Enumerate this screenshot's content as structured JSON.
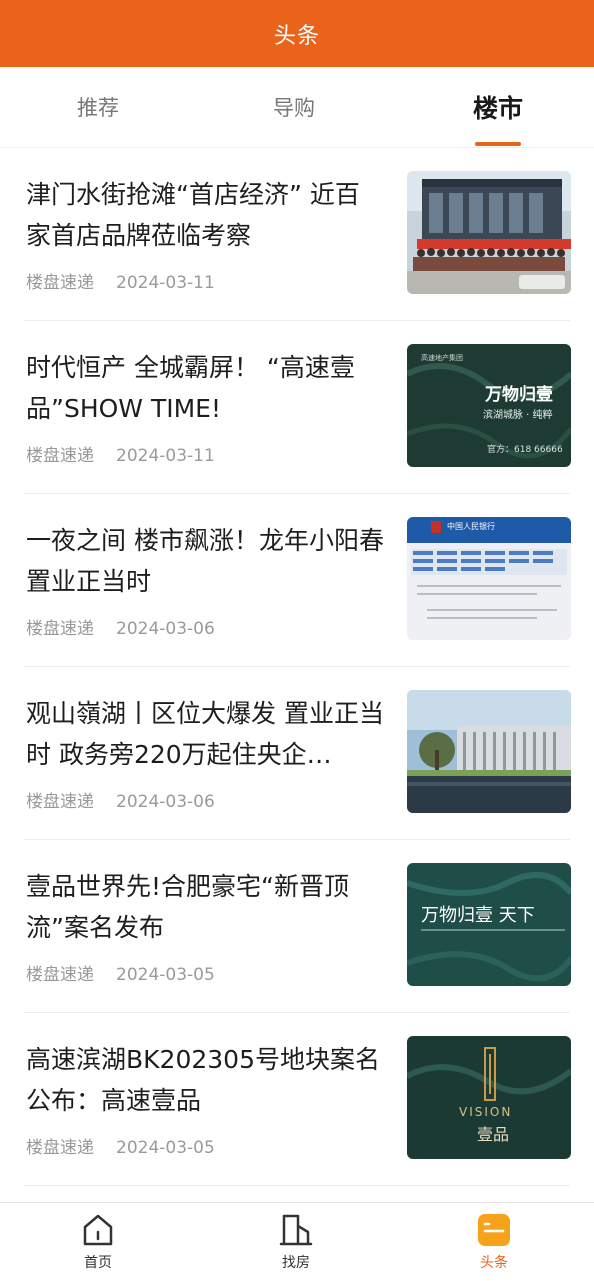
{
  "header": {
    "title": "头条"
  },
  "tabs": [
    {
      "label": "推荐",
      "active": false
    },
    {
      "label": "导购",
      "active": false
    },
    {
      "label": "楼市",
      "active": true
    }
  ],
  "articles": [
    {
      "title": "津门水街抢滩“首店经济” 近百家首店品牌莅临考察",
      "source": "楼盘速递",
      "date": "2024-03-11",
      "thumb": "building-crowd-photo"
    },
    {
      "title": "时代恒产 全城霸屏！ “高速壹品”SHOW TIME!",
      "source": "楼盘速递",
      "date": "2024-03-11",
      "thumb": "green-marble-ad"
    },
    {
      "title": "一夜之间 楼市飙涨！龙年小阳春 置业正当时",
      "source": "楼盘速递",
      "date": "2024-03-06",
      "thumb": "bank-document"
    },
    {
      "title": "观山嶺湖丨区位大爆发 置业正当时 政务旁220万起住央企…",
      "source": "楼盘速递",
      "date": "2024-03-06",
      "thumb": "modern-building-photo"
    },
    {
      "title": "壹品世界先!合肥豪宅“新晋顶流”案名发布",
      "source": "楼盘速递",
      "date": "2024-03-05",
      "thumb": "teal-marble-ad"
    },
    {
      "title": "高速滨湖BK202305号地块案名公布：高速壹品",
      "source": "楼盘速递",
      "date": "2024-03-05",
      "thumb": "vision-logo-ad"
    }
  ],
  "thumb_text": {
    "ad1_headline": "万物归壹",
    "ad1_sub": "滨湖城脉 · 纯粹",
    "ad1_phone": "官方：618 66666",
    "ad1_brand": "高速地产集团",
    "bank_name": "中国人民银行",
    "ad2_headline": "万物归壹 天下",
    "ad3_word": "VISION",
    "ad3_name": "壹品"
  },
  "bottom_nav": [
    {
      "label": "首页",
      "icon": "home-icon",
      "active": false
    },
    {
      "label": "找房",
      "icon": "building-icon",
      "active": false
    },
    {
      "label": "头条",
      "icon": "news-icon",
      "active": true
    }
  ],
  "colors": {
    "accent": "#ea631b"
  }
}
